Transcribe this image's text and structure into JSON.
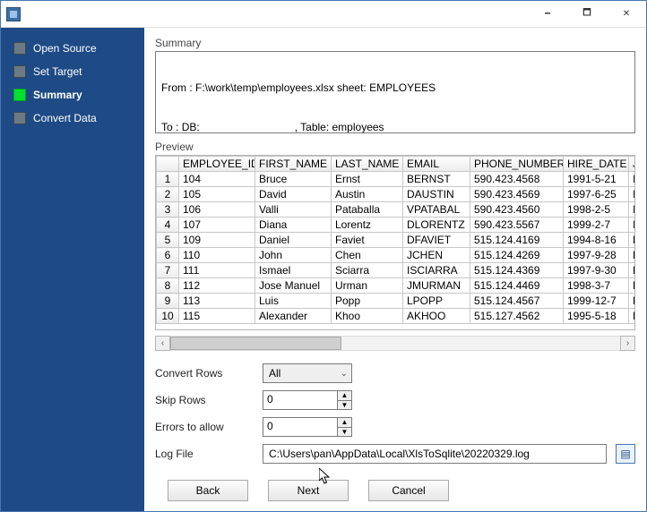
{
  "window": {
    "title": "",
    "min_glyph": "🗕",
    "max_glyph": "🗖",
    "close_glyph": "✕"
  },
  "nav": {
    "items": [
      {
        "label": "Open Source"
      },
      {
        "label": "Set Target"
      },
      {
        "label": "Summary"
      },
      {
        "label": "Convert Data"
      }
    ],
    "active_index": 2
  },
  "summary": {
    "label": "Summary",
    "from_prefix": "From : ",
    "from_path": "F:\\work\\temp\\employees.xlsx sheet: EMPLOYEES",
    "to_prefix": "To : ",
    "to_db": "DB:",
    "to_table": ", Table: employees"
  },
  "preview": {
    "label": "Preview",
    "columns": [
      "EMPLOYEE_ID",
      "FIRST_NAME",
      "LAST_NAME",
      "EMAIL",
      "PHONE_NUMBER",
      "HIRE_DATE",
      "JOB_ID"
    ],
    "rows": [
      [
        "104",
        "Bruce",
        "Ernst",
        "BERNST",
        "590.423.4568",
        "1991-5-21",
        "IT_PROG"
      ],
      [
        "105",
        "David",
        "Austin",
        "DAUSTIN",
        "590.423.4569",
        "1997-6-25",
        "IT_PROG"
      ],
      [
        "106",
        "Valli",
        "Pataballa",
        "VPATABAL",
        "590.423.4560",
        "1998-2-5",
        "IT_PROG"
      ],
      [
        "107",
        "Diana",
        "Lorentz",
        "DLORENTZ",
        "590.423.5567",
        "1999-2-7",
        "IT_PROG"
      ],
      [
        "109",
        "Daniel",
        "Faviet",
        "DFAVIET",
        "515.124.4169",
        "1994-8-16",
        "FI_ACCOUNT"
      ],
      [
        "110",
        "John",
        "Chen",
        "JCHEN",
        "515.124.4269",
        "1997-9-28",
        "FI_ACCOUNT"
      ],
      [
        "111",
        "Ismael",
        "Sciarra",
        "ISCIARRA",
        "515.124.4369",
        "1997-9-30",
        "FI_ACCOUNT"
      ],
      [
        "112",
        "Jose Manuel",
        "Urman",
        "JMURMAN",
        "515.124.4469",
        "1998-3-7",
        "FI_ACCOUNT"
      ],
      [
        "113",
        "Luis",
        "Popp",
        "LPOPP",
        "515.124.4567",
        "1999-12-7",
        "FI_ACCOUNT"
      ],
      [
        "115",
        "Alexander",
        "Khoo",
        "AKHOO",
        "515.127.4562",
        "1995-5-18",
        "PU_CLERK"
      ]
    ]
  },
  "form": {
    "convert_rows_label": "Convert Rows",
    "convert_rows_value": "All",
    "skip_rows_label": "Skip Rows",
    "skip_rows_value": "0",
    "errors_label": "Errors to allow",
    "errors_value": "0",
    "logfile_label": "Log File",
    "logfile_value": "C:\\Users\\pan\\AppData\\Local\\XlsToSqlite\\20220329.log"
  },
  "buttons": {
    "back": "Back",
    "next": "Next",
    "cancel": "Cancel"
  },
  "glyphs": {
    "chevron_down": "⌄",
    "chevron_left": "‹",
    "chevron_right": "›",
    "triangle_up": "▲",
    "triangle_down": "▼",
    "browse": "▤"
  }
}
